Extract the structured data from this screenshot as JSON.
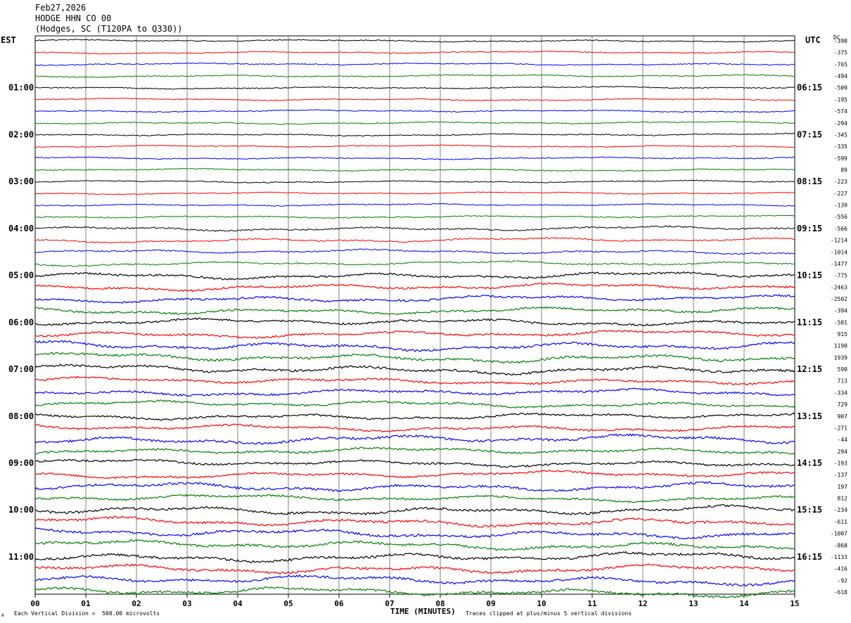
{
  "header": {
    "date": "Feb27,2026",
    "station": "HODGE HHN CO 00",
    "location": "(Hodges, SC (T120PA to Q330))"
  },
  "left_timezone": "EST",
  "right_timezone": "UTC",
  "dc_label": "DC",
  "footer": {
    "vertical_division": "Each Vertical Division =  500.00 microvolts",
    "clip_note": "Traces clipped at plus/minus 5 vertical divisions",
    "corner_mark": "A"
  },
  "colors": {
    "black": "#000000",
    "red": "#ff0000",
    "blue": "#0000ff",
    "green": "#007f00",
    "grid": "#808080"
  },
  "chart_data": {
    "type": "line",
    "xlabel": "TIME (MINUTES)",
    "xlim": [
      0,
      15
    ],
    "x_ticks": [
      "00",
      "01",
      "02",
      "03",
      "04",
      "05",
      "06",
      "07",
      "08",
      "09",
      "10",
      "11",
      "12",
      "13",
      "14",
      "15"
    ],
    "trace_color_cycle": [
      "black",
      "red",
      "blue",
      "green"
    ],
    "left_hour_labels": [
      "01:00",
      "02:00",
      "03:00",
      "04:00",
      "05:00",
      "06:00",
      "07:00",
      "08:00",
      "09:00",
      "10:00",
      "11:00"
    ],
    "right_hour_labels": [
      "06:15",
      "07:15",
      "08:15",
      "09:15",
      "10:15",
      "11:15",
      "12:15",
      "13:15",
      "14:15",
      "15:15",
      "16:15"
    ],
    "dc_offsets": [
      "-398",
      "-375",
      "-765",
      "-494",
      "-509",
      "-195",
      "-574",
      "-294",
      "-345",
      "-335",
      "-599",
      "89",
      "-223",
      "-227",
      "-139",
      "-556",
      "-566",
      "-1214",
      "-1014",
      "-1477",
      "-775",
      "-2463",
      "-2502",
      "-394",
      "-581",
      "915",
      "1190",
      "1939",
      "590",
      "713",
      "-334",
      "729",
      "907",
      "-271",
      "-44",
      "294",
      "-193",
      "-137",
      "197",
      "812",
      "-234",
      "-611",
      "-1007",
      "-868",
      "-1133",
      "-416",
      "-92",
      "-618"
    ],
    "trace_activity": [
      1,
      1,
      1,
      1,
      1,
      1,
      1,
      1,
      1,
      1,
      1,
      1,
      1,
      1,
      1,
      1,
      2,
      2,
      2,
      2,
      3,
      3,
      3,
      3,
      3,
      3,
      4,
      4,
      4,
      3,
      3,
      3,
      3,
      3,
      4,
      3,
      3,
      3,
      4,
      3,
      4,
      4,
      4,
      4,
      4,
      4,
      4,
      4
    ]
  }
}
